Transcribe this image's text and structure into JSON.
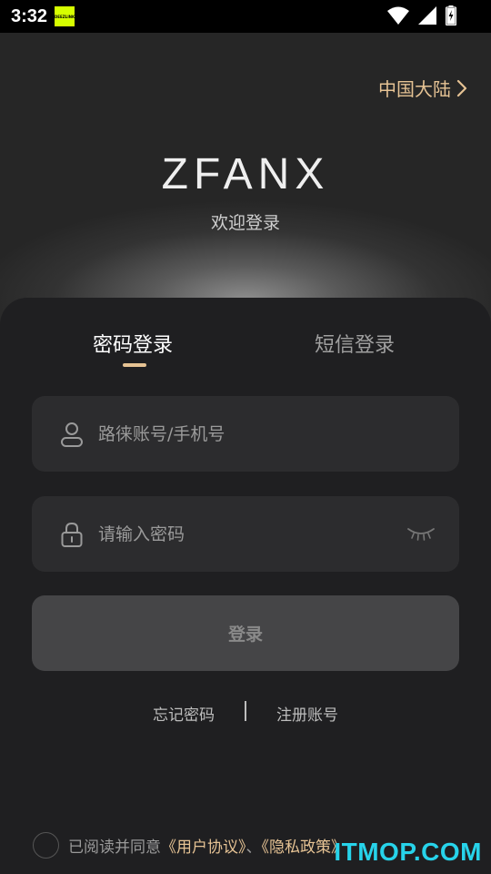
{
  "status_bar": {
    "time": "3:32",
    "notif_label": "DEEZLINK"
  },
  "header": {
    "region": "中国大陆",
    "logo": "ZFANX",
    "welcome": "欢迎登录"
  },
  "tabs": [
    {
      "label": "密码登录",
      "active": true
    },
    {
      "label": "短信登录",
      "active": false
    }
  ],
  "form": {
    "account_placeholder": "路徕账号/手机号",
    "password_placeholder": "请输入密码",
    "login_label": "登录"
  },
  "links": {
    "forgot": "忘记密码",
    "register": "注册账号"
  },
  "agreement": {
    "prefix": "已阅读并同意",
    "user_agreement": "《用户协议》",
    "separator": "、",
    "privacy_policy": "《隐私政策》"
  },
  "watermark": "ITMOP.COM",
  "colors": {
    "accent": "#e6c394",
    "watermark": "#27d3ea"
  }
}
